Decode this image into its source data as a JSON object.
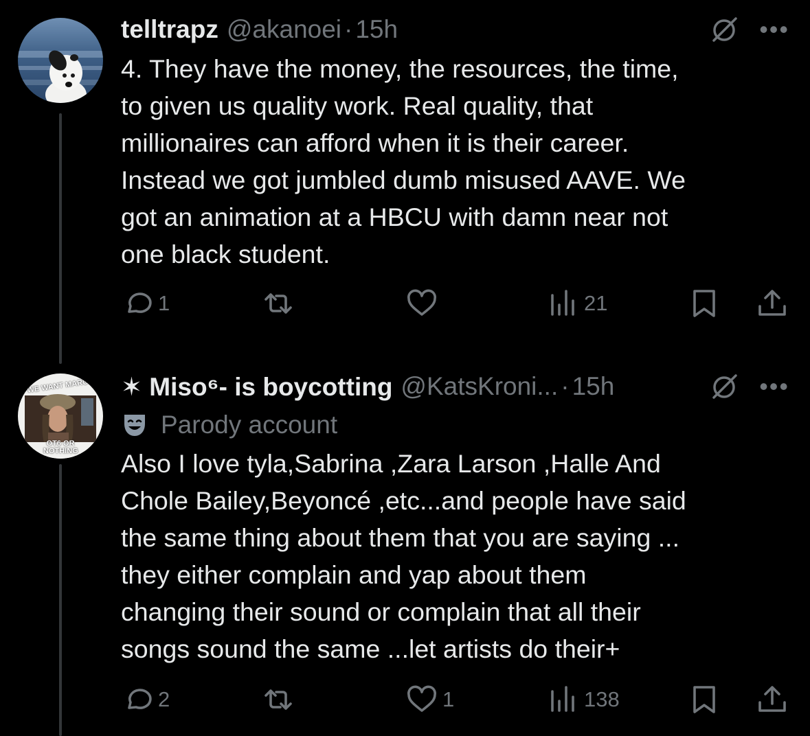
{
  "tweets": [
    {
      "name": "telltrapz",
      "handle": "@akanoei",
      "separator": "·",
      "time": "15h",
      "body_lines": [
        "4. They have the money, the resources, the time,",
        "to given us quality work. Real quality, that",
        "millionaires can afford when it is their career.",
        "Instead we got jumbled dumb misused AAVE. We",
        "got an animation at a HBCU with damn near not",
        "one black student."
      ],
      "replies": "1",
      "retweets": "",
      "likes": "",
      "views": "21"
    },
    {
      "name": "✶ Miso⁶- is boycotting",
      "handle": "@KatsKroni...",
      "separator": "·",
      "time": "15h",
      "label": "Parody account",
      "avatar_text_top": "WE WANT MARON",
      "avatar_text_bottom": "OT6 OR NOTHING",
      "body_lines": [
        "Also I love tyla,Sabrina ,Zara Larson ,Halle And",
        "Chole Bailey,Beyoncé ,etc...and people have said",
        "the same thing about them that you are saying ...",
        "they either complain and yap about them",
        "changing their sound or complain that all their",
        "songs sound the same ...let artists do their+"
      ],
      "replies": "2",
      "retweets": "",
      "likes": "1",
      "views": "138"
    }
  ],
  "icons": {
    "reply": "reply-icon",
    "retweet": "retweet-icon",
    "like": "heart-icon",
    "views": "views-icon",
    "bookmark": "bookmark-icon",
    "share": "share-icon",
    "grok": "grok-icon",
    "more": "more-icon"
  },
  "colors": {
    "background": "#000000",
    "text": "#e7e9ea",
    "muted": "#71767b",
    "thread": "#333639"
  }
}
